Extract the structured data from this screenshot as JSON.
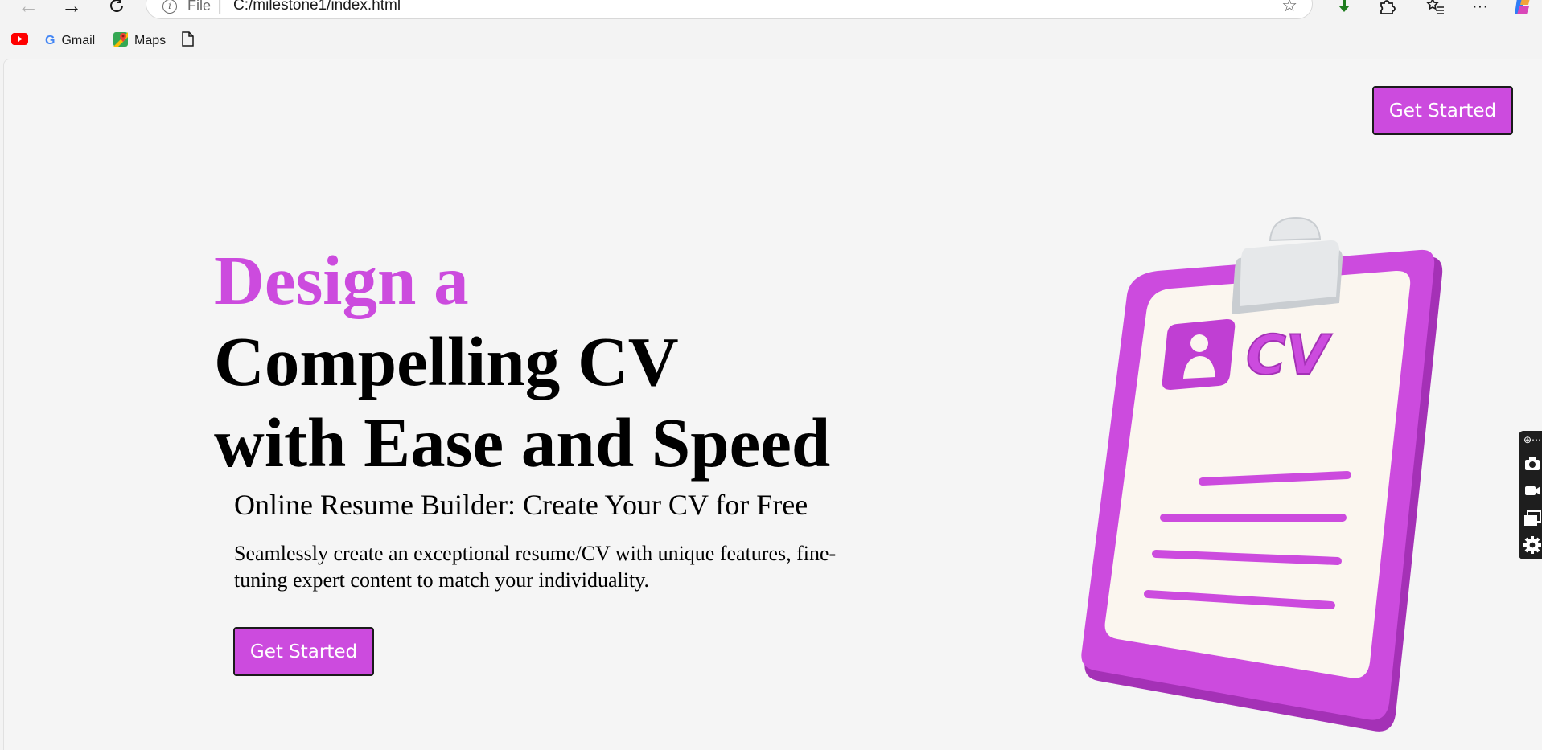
{
  "browser": {
    "address": {
      "scheme_label": "File",
      "separator": "|",
      "url": "C:/milestone1/index.html"
    },
    "toolbar_icons": [
      "back-icon",
      "forward-icon",
      "refresh-icon",
      "info-icon",
      "star-icon",
      "download-icon",
      "extensions-icon",
      "favorites-icon",
      "more-icon",
      "copilot-icon"
    ],
    "bookmarks": [
      {
        "label": "",
        "icon": "youtube-icon"
      },
      {
        "label": "Gmail",
        "icon": "google-icon"
      },
      {
        "label": "Maps",
        "icon": "maps-icon"
      },
      {
        "label": "",
        "icon": "document-icon"
      }
    ]
  },
  "page": {
    "header_button": "Get Started",
    "hero": {
      "title_accent": "Design a",
      "title_line2": "Compelling CV",
      "title_line3": "with Ease and Speed",
      "subtitle": "Online Resume Builder: Create Your CV for Free",
      "description": "Seamlessly create an exceptional resume/CV with unique features, fine-tuning expert content to match your individuality.",
      "cta_button": "Get Started"
    },
    "illustration": {
      "label": "CV"
    }
  },
  "side_panel": {
    "icons": [
      "camera-icon",
      "video-icon",
      "window-icon",
      "settings-icon"
    ]
  },
  "colors": {
    "accent": "#cc4bde",
    "page_background": "#f5f5f5",
    "paper": "#fbf6ef",
    "clip_metal": "#e6e8ea"
  }
}
